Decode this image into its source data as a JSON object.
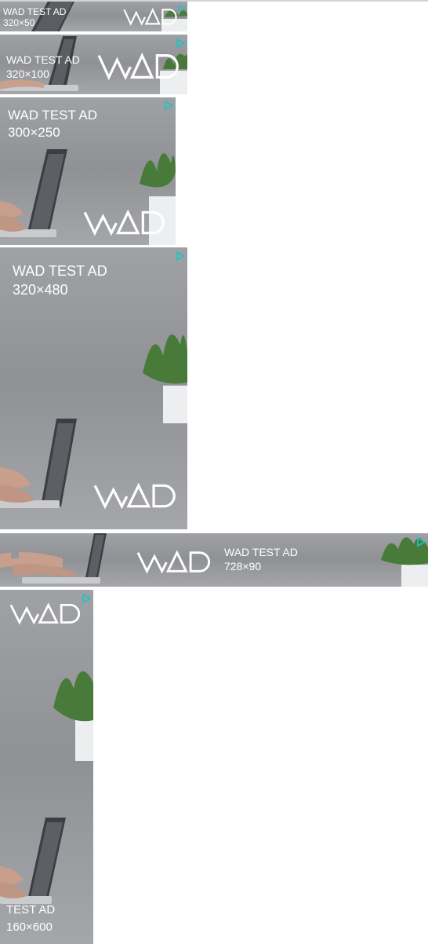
{
  "colors": {
    "ad_background": "#969899",
    "ad_text": "#ffffff",
    "ad_choices_icon": "#1ec3c3",
    "top_rule": "#d2d2d2"
  },
  "icons": {
    "ad_choices": "ad-choices-play-triangle-icon",
    "logo": "wad-logo"
  },
  "ads": [
    {
      "headline": "WAD TEST AD",
      "size": "320×50"
    },
    {
      "headline": "WAD TEST AD",
      "size": "320×100"
    },
    {
      "headline": "WAD TEST AD",
      "size": "300×250"
    },
    {
      "headline": "WAD TEST AD",
      "size": "320×480"
    },
    {
      "headline": "WAD TEST AD",
      "size": "728×90"
    },
    {
      "headline": "TEST AD",
      "size": "160×600"
    }
  ]
}
